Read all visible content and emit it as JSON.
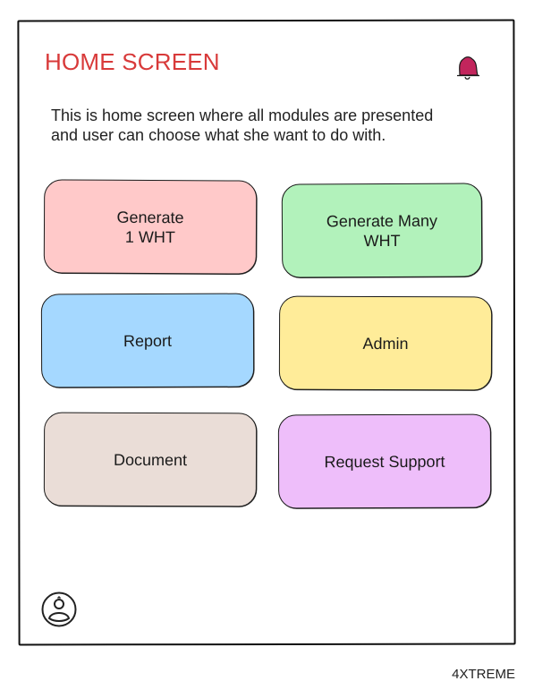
{
  "header": {
    "title": "HOME SCREEN",
    "icons": [
      "bell-icon"
    ],
    "accent_color": "#d83a3a",
    "bell_color": "#c2255c"
  },
  "description": "This is home screen where all modules are presented\nand user can choose what she want to do with.",
  "modules": [
    {
      "label": "Generate\n1 WHT",
      "color": "#ffc9c9"
    },
    {
      "label": "Generate Many\nWHT",
      "color": "#b2f2bb"
    },
    {
      "label": "Report",
      "color": "#a5d8ff"
    },
    {
      "label": "Admin",
      "color": "#ffec99"
    },
    {
      "label": "Document",
      "color": "#eaddd7"
    },
    {
      "label": "Request Support",
      "color": "#eebefa"
    }
  ],
  "footer": {
    "profile_icon": "user-profile-icon",
    "brand": "4XTREME"
  }
}
